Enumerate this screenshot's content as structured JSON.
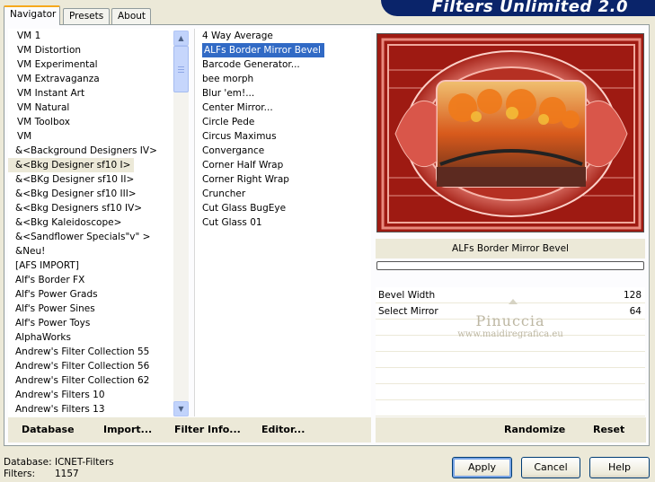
{
  "tabs": [
    "Navigator",
    "Presets",
    "About"
  ],
  "brand": "Filters Unlimited 2.0",
  "categories": [
    "VM 1",
    "VM Distortion",
    "VM Experimental",
    "VM Extravaganza",
    "VM Instant Art",
    "VM Natural",
    "VM Toolbox",
    "VM",
    "&<Background Designers IV>",
    "&<Bkg Designer sf10 I>",
    "&<BKg Designer sf10 II>",
    "&<Bkg Designer sf10 III>",
    "&<Bkg Designers sf10 IV>",
    "&<Bkg Kaleidoscope>",
    "&<Sandflower Specials\"v\" >",
    "&Neu!",
    "[AFS IMPORT]",
    "Alf's Border FX",
    "Alf's Power Grads",
    "Alf's Power Sines",
    "Alf's Power Toys",
    "AlphaWorks",
    "Andrew's Filter Collection 55",
    "Andrew's Filter Collection 56",
    "Andrew's Filter Collection 62",
    "Andrew's Filters 10",
    "Andrew's Filters 13"
  ],
  "selected_category": "&<Bkg Designer sf10 I>",
  "filters": [
    "4 Way Average",
    "ALFs Border Mirror Bevel",
    "Barcode Generator...",
    "bee morph",
    "Blur 'em!...",
    "Center Mirror...",
    "Circle Pede",
    "Circus Maximus",
    "Convergance",
    "Corner Half Wrap",
    "Corner Right Wrap",
    "Cruncher",
    "Cut Glass  BugEye",
    "Cut Glass 01"
  ],
  "selected_filter": "ALFs Border Mirror Bevel",
  "left_buttons": {
    "database": "Database",
    "import": "Import...",
    "filter_info": "Filter Info...",
    "editor": "Editor..."
  },
  "current_filter_name": "ALFs Border Mirror Bevel",
  "params": [
    {
      "label": "Bevel Width",
      "value": "128"
    },
    {
      "label": "Select Mirror",
      "value": "64"
    }
  ],
  "watermark": {
    "name": "Pinuccia",
    "url": "www.maidiregrafica.eu"
  },
  "right_buttons": {
    "randomize": "Randomize",
    "reset": "Reset"
  },
  "footer": {
    "database_label": "Database:",
    "database_value": "ICNET-Filters",
    "filters_label": "Filters:",
    "filters_value": "1157"
  },
  "dialog_buttons": {
    "apply": "Apply",
    "cancel": "Cancel",
    "help": "Help"
  },
  "colors": {
    "selection": "#316ac5",
    "brand_bg": "#0a246a",
    "preview_bg": "#9e1a12"
  }
}
